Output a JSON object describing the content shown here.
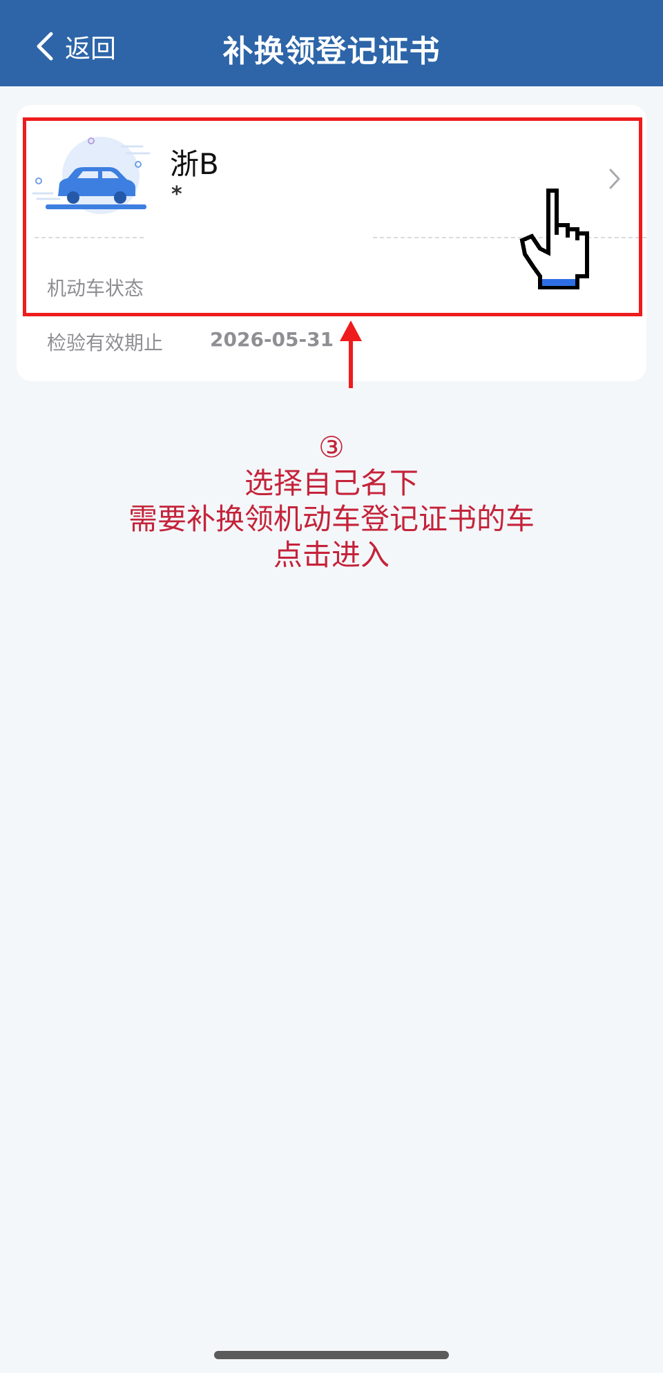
{
  "header": {
    "back_label": "返回",
    "title": "补换领登记证书",
    "back_icon": "chevron-left-icon",
    "background_color": "#2d65a8"
  },
  "vehicle_card": {
    "plate": "浙B",
    "plate_masked": "*",
    "status_label": "机动车状态",
    "inspection_label": "检验有效期止",
    "inspection_date": "2026-05-31",
    "icons": [
      "car-icon",
      "chevron-right-icon"
    ]
  },
  "annotation": {
    "step": "③",
    "line1": "选择自己名下",
    "line2": "需要补换领机动车登记证书的车",
    "line3": "点击进入",
    "color": "#c4233a"
  },
  "overlay": {
    "highlight_color": "#ee1c1c",
    "icons": [
      "hand-pointer-icon",
      "arrow-up-icon"
    ]
  }
}
